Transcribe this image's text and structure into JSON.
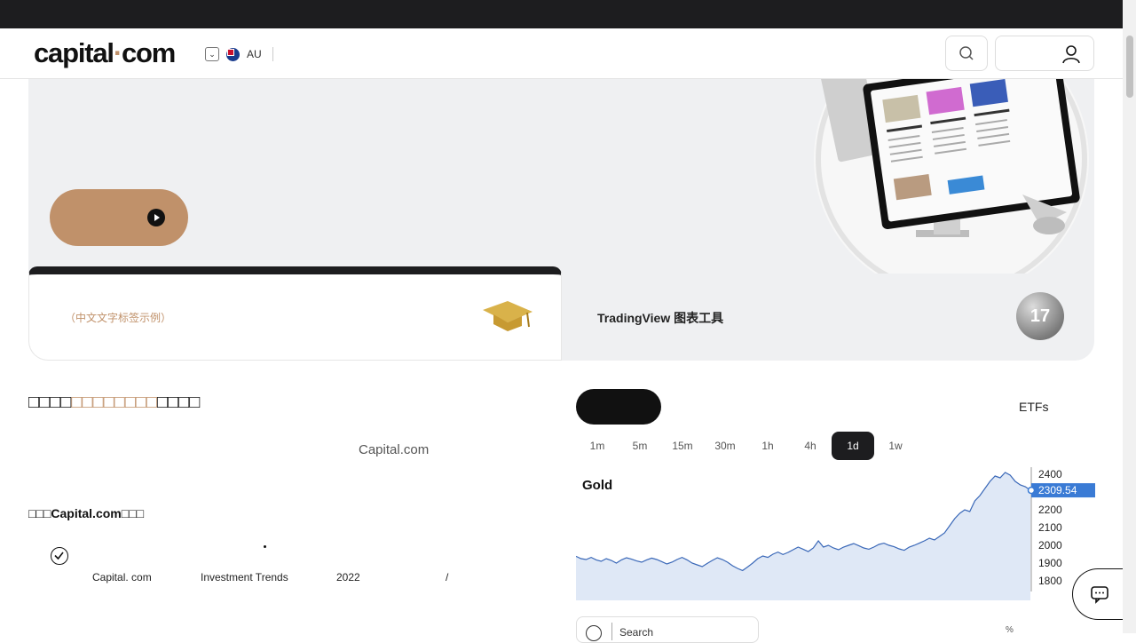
{
  "header": {
    "logo_main": "capital",
    "logo_dot": "·",
    "logo_tld": "com",
    "region_code": "AU"
  },
  "hero": {},
  "tabs": {
    "left_label": "（中文文字标签示例）",
    "right_label": " TradingView 图表工具"
  },
  "content": {
    "section_title_pre": "□□□□",
    "section_title_accent": "□□□□□□□□",
    "section_title_post": "□□□□",
    "brand_text": "Capital.com",
    "why_title_pre": "□□□",
    "why_title_brand": "Capital.com",
    "why_title_post": "□□□",
    "why_line": {
      "a": "Capital. com",
      "b": "Investment Trends",
      "c": "2022",
      "d": "/"
    }
  },
  "market": {
    "etf_tab": "ETFs",
    "timeframes": [
      "1m",
      "5m",
      "15m",
      "30m",
      "1h",
      "4h",
      "1d",
      "1w"
    ],
    "active_timeframe": "1d",
    "search_placeholder": "Search",
    "pct_label": "%"
  },
  "chart_data": {
    "type": "area",
    "title": "Gold",
    "current_value": "2309.54",
    "y_ticks": [
      "2400",
      "2200",
      "2100",
      "2000",
      "1900",
      "1800"
    ],
    "ylim": [
      1780,
      2420
    ],
    "values": [
      1938,
      1925,
      1920,
      1932,
      1918,
      1910,
      1925,
      1915,
      1900,
      1918,
      1930,
      1922,
      1912,
      1905,
      1918,
      1928,
      1920,
      1908,
      1895,
      1905,
      1920,
      1932,
      1918,
      1900,
      1890,
      1880,
      1898,
      1915,
      1930,
      1920,
      1905,
      1885,
      1870,
      1858,
      1878,
      1900,
      1925,
      1940,
      1932,
      1950,
      1962,
      1948,
      1960,
      1975,
      1990,
      1978,
      1965,
      1985,
      2025,
      1990,
      2000,
      1985,
      1975,
      1990,
      2000,
      2010,
      1998,
      1985,
      1978,
      1990,
      2005,
      2012,
      2000,
      1992,
      1980,
      1972,
      1990,
      2000,
      2012,
      2025,
      2040,
      2030,
      2050,
      2070,
      2110,
      2150,
      2180,
      2200,
      2190,
      2250,
      2280,
      2320,
      2360,
      2390,
      2380,
      2410,
      2395,
      2360,
      2340,
      2330,
      2310
    ]
  },
  "colors": {
    "accent": "#c0916a",
    "dark": "#1d1d1f",
    "chart_line": "#3a68b8",
    "chart_fill": "#dfe8f6",
    "price_tag": "#3a7bd5"
  },
  "icons": [
    "chevron-down-icon",
    "australia-flag-icon",
    "search-icon",
    "user-icon",
    "play-icon",
    "graduation-cap-icon",
    "tradingview-icon",
    "check-circle-icon",
    "chat-icon"
  ]
}
